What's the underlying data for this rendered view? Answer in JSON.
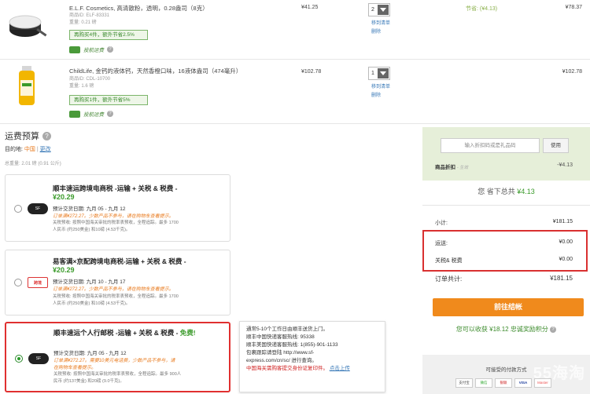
{
  "cart": {
    "items": [
      {
        "name": "E.L.F. Cosmetics, 高清散粉，透明，0.28盎司（8克）",
        "product_id": "商品ID: ELF-83331",
        "weight": "重量: 0.21 磅",
        "promo": "再购买4件，额外节省2.5%",
        "shipping_note": "投航运费",
        "price": "¥41.25",
        "qty": "2",
        "move_to_wishlist": "移到清单",
        "delete": "删除",
        "save_text": "节省: (¥4.13)",
        "total": "¥78.37"
      },
      {
        "name": "ChildLife, 金钙的液体钙，天然香橙口味，16液体盎司（474毫升）",
        "product_id": "商品ID: CDL-10700",
        "weight": "重量: 1.6 磅",
        "promo": "再购买1件，额外节省5%",
        "shipping_note": "投航运费",
        "price": "¥102.78",
        "qty": "1",
        "move_to_wishlist": "移到清单",
        "delete": "删除",
        "total": "¥102.78"
      }
    ]
  },
  "shipping": {
    "title": "运费预算",
    "dest_label": "目的地:",
    "dest_value": "中国",
    "dest_change": "更改",
    "weight": "总重量: 2.01 磅 (0.91 公斤)",
    "options": [
      {
        "title": "顺丰速运跨境电商税 -运输 + 关税 & 税费 -",
        "title_extra": "",
        "price": "¥20.29",
        "eta": "预计交货日期: 九月 05 - 九月 12",
        "note1": "订单满¥272.27。少数产品不参与，请在购物车查看提示。",
        "note2": "",
        "small1": "关税预收: 按照中国海关审批的税率表预收，全程追踪。最多 1700",
        "small2": "人民币 (约250美金) 和10磅 (4.53千克)。",
        "logo": "SF",
        "selected": false
      },
      {
        "title": "易客满×京配跨境电商税-运输 + 关税 & 税费 -",
        "title_extra": "",
        "price": "¥20.29",
        "eta": "预计交货日期: 九月 10 - 九月 17",
        "note1": "订单满¥272.27。少数产品不参与，请在购物车查看提示。",
        "note2": "",
        "small1": "关税预收: 按照中国海关审批的税率表预收，全程追踪。最多 1700",
        "small2": "人民币 (约250美金) 和10磅 (4.53千克)。",
        "logo": "跨境",
        "selected": false
      },
      {
        "title": "顺丰速运个人行邮税 -运输 + 关税 & 税费 - ",
        "title_extra": "免费!",
        "price": "",
        "eta": "预计交货日期: 九月 05 - 九月 12",
        "note1": "订单满¥272.27。需要10美元电话费，少数产品不参与，请",
        "note2": "在购物车查看提示。",
        "small1": "关税预收: 按照中国海关审批的税率表预收，全程追踪。最多 900人",
        "small2": "民币 (约137美金) 和20磅 (9.0千克)。",
        "logo": "SF",
        "selected": true
      }
    ],
    "tooltip": {
      "line1": "通常5-10个工作日由顺丰送货上门。",
      "line2": "顺丰中国快递客服热线: 95338",
      "line3": "顺丰美国快递客服热线: 1(855)-901-1133",
      "line4": "包裹跟踪请登陆 http://www.sf-",
      "line5": "express.com/cn/sc/ 进行查询。",
      "warn": "中国海关需购客提交身份证复印件。",
      "link": "点击上传"
    }
  },
  "summary": {
    "coupon_placeholder": "输入折扣码或是礼品码",
    "use_button": "使用",
    "discount_label": "商品折扣",
    "discount_tag": "- 生效",
    "discount_value": "-¥4.13",
    "saved_prefix": "您 省下总共",
    "saved_amount": "¥4.13",
    "subtotal_label": "小计:",
    "subtotal_value": "¥181.15",
    "shipping_label": "运送:",
    "shipping_value": "¥0.00",
    "tax_label": "关税& 税费",
    "tax_value": "¥0.00",
    "order_total_label": "订单共计:",
    "order_total_value": "¥181.15",
    "checkout_button": "前往结帐",
    "points_text": "您可以收获 ¥18.12 忠诚奖励积分",
    "pay_title": "可接受的付款方式",
    "pay_methods": [
      "支付宝",
      "微信",
      "银联",
      "VISA",
      "Master"
    ],
    "watermark": "55海淘"
  },
  "colors": {
    "accent_green": "#3a9a2a",
    "accent_orange": "#f08a1c",
    "highlight_red": "#d93030",
    "summary_bg": "#e6efd9"
  }
}
